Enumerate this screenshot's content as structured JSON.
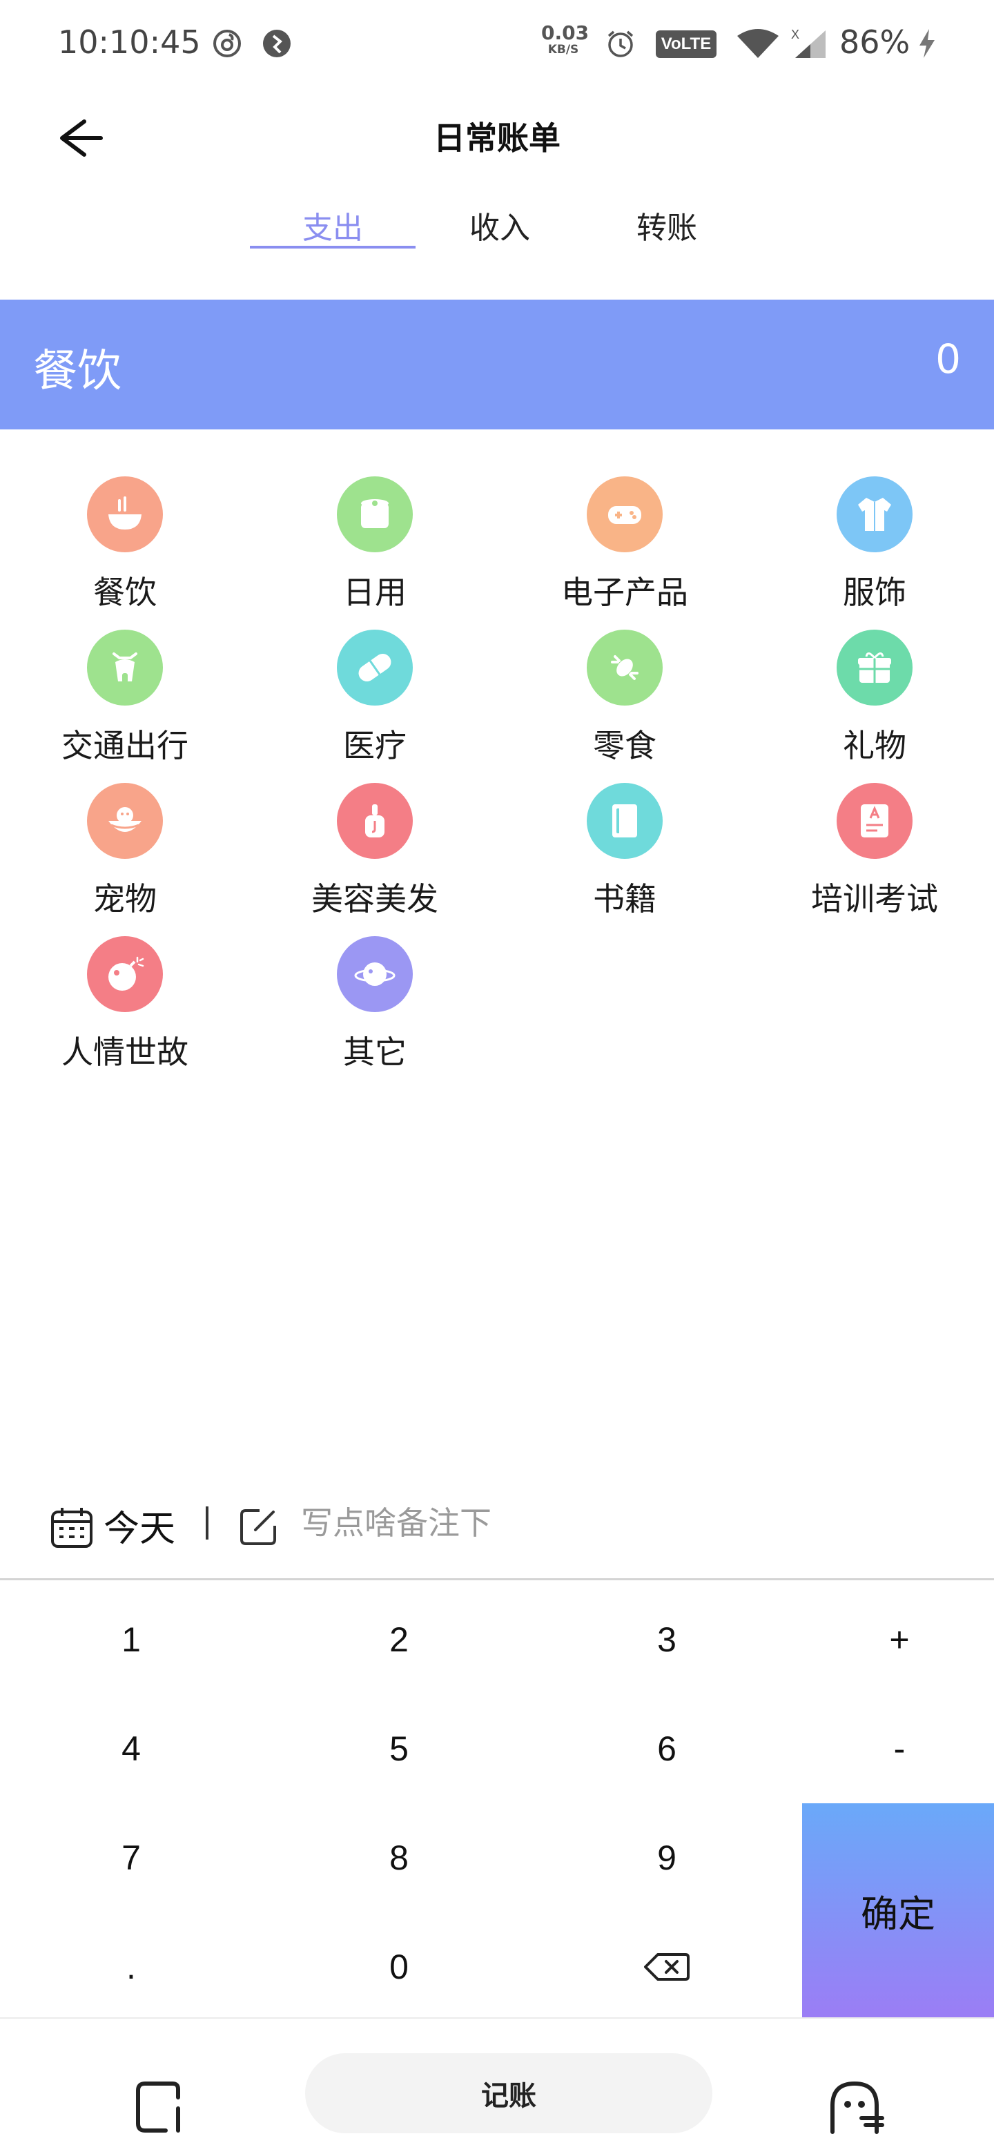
{
  "status_bar": {
    "time": "10:10:45",
    "net_speed_value": "0.03",
    "net_speed_unit": "KB/S",
    "volte": "VoLTE",
    "sim_label": "X",
    "battery": "86%"
  },
  "header": {
    "title": "日常账单",
    "back_icon": "arrow-left-icon"
  },
  "tabs": [
    {
      "label": "支出",
      "active": true
    },
    {
      "label": "收入",
      "active": false
    },
    {
      "label": "转账",
      "active": false
    }
  ],
  "banner": {
    "category": "餐饮",
    "amount": "0",
    "color": "#7f9bf7"
  },
  "categories": [
    {
      "label": "餐饮",
      "icon": "bowl-icon",
      "color": "#f8a48a"
    },
    {
      "label": "日用",
      "icon": "toilet-paper-icon",
      "color": "#9ee28e"
    },
    {
      "label": "电子产品",
      "icon": "gamepad-icon",
      "color": "#f9b487"
    },
    {
      "label": "服饰",
      "icon": "shirt-icon",
      "color": "#7dc6f6"
    },
    {
      "label": "交通出行",
      "icon": "scooter-icon",
      "color": "#9ee28e"
    },
    {
      "label": "医疗",
      "icon": "pill-icon",
      "color": "#6fdadb"
    },
    {
      "label": "零食",
      "icon": "candy-icon",
      "color": "#9ee28e"
    },
    {
      "label": "礼物",
      "icon": "gift-icon",
      "color": "#6ddbaa"
    },
    {
      "label": "宠物",
      "icon": "pet-icon",
      "color": "#f8a48a"
    },
    {
      "label": "美容美发",
      "icon": "cosmetics-icon",
      "color": "#f47e86"
    },
    {
      "label": "书籍",
      "icon": "book-icon",
      "color": "#6fdadb"
    },
    {
      "label": "培训考试",
      "icon": "exam-icon",
      "color": "#f47e86"
    },
    {
      "label": "人情世故",
      "icon": "bomb-icon",
      "color": "#f47e86"
    },
    {
      "label": "其它",
      "icon": "planet-icon",
      "color": "#9b97f3"
    }
  ],
  "remark": {
    "date": "今天",
    "placeholder": "写点啥备注下"
  },
  "keypad": {
    "keys": [
      "1",
      "2",
      "3",
      "+",
      "4",
      "5",
      "6",
      "-",
      "7",
      "8",
      "9",
      ".",
      "0"
    ],
    "backspace_icon": "backspace-icon",
    "confirm": "确定"
  },
  "bottom_nav": {
    "center_label": "记账",
    "left_icon": "square-corner-icon",
    "right_icon": "face-icon"
  }
}
